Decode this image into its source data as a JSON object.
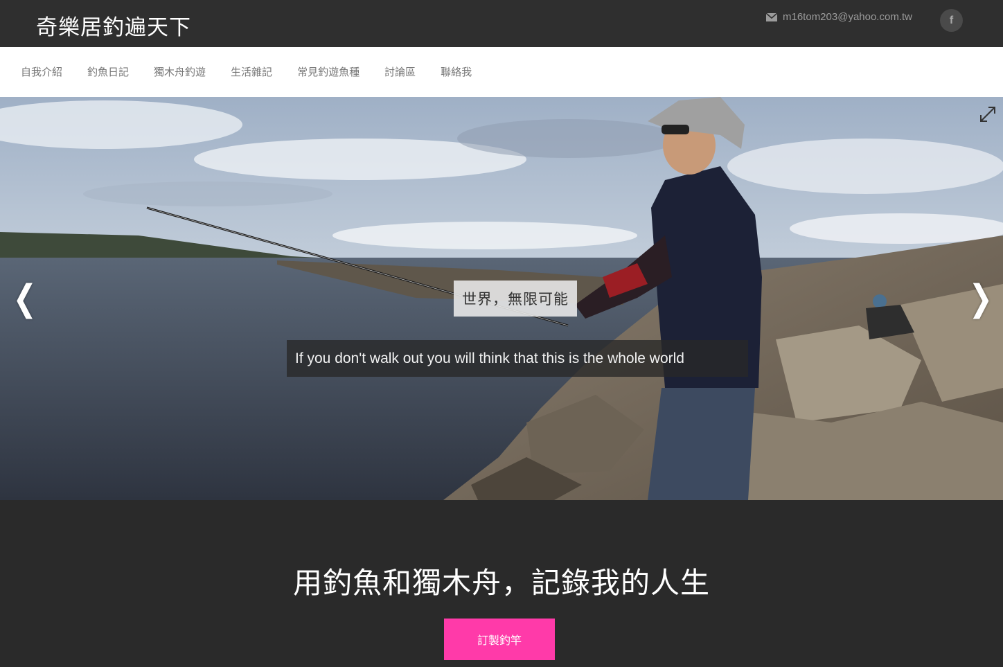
{
  "header": {
    "site_title": "奇樂居釣遍天下",
    "email": "m16tom203@yahoo.com.tw",
    "email_icon": "envelope-icon",
    "social_icon": "facebook-icon",
    "social_label": "f"
  },
  "nav": {
    "items": [
      {
        "label": "自我介紹"
      },
      {
        "label": "釣魚日記"
      },
      {
        "label": "獨木舟釣遊"
      },
      {
        "label": "生活雜記"
      },
      {
        "label": "常見釣遊魚種"
      },
      {
        "label": "討論區"
      },
      {
        "label": "聯絡我"
      }
    ]
  },
  "hero": {
    "caption_title": "世界，無限可能",
    "caption_subtitle": "If you don't walk out you will think that this is the whole world",
    "prev_arrow": "❮",
    "next_arrow": "❯",
    "expand_icon": "expand-icon"
  },
  "main": {
    "tagline": "用釣魚和獨木舟，記錄我的人生",
    "cta_label": "訂製釣竿"
  },
  "colors": {
    "topbar": "#2f2f2f",
    "page_bg": "#2a2a2a",
    "cta": "#ff3aa9"
  }
}
